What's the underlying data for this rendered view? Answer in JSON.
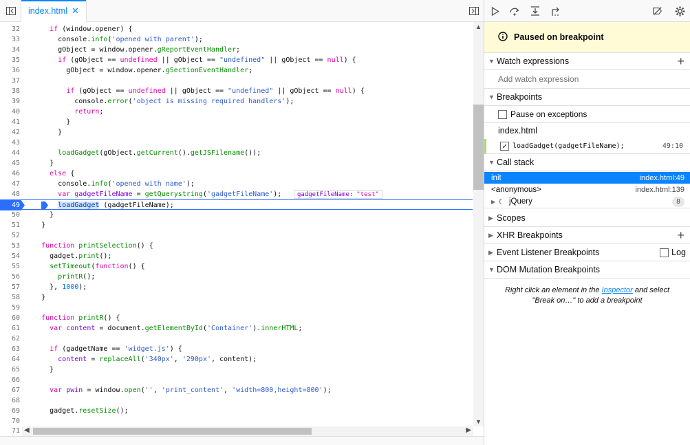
{
  "tab": {
    "filename": "index.html",
    "close": "✕"
  },
  "editor": {
    "lines": [
      {
        "n": "32",
        "html": "      <span class='kw'>if</span> (window.opener) {"
      },
      {
        "n": "33",
        "html": "        console.<span class='prop'>info</span>(<span class='str'>'opened with parent'</span>);"
      },
      {
        "n": "34",
        "html": "        gObject = window.opener.<span class='prop'>gReportEventHandler</span>;"
      },
      {
        "n": "35",
        "html": "        <span class='kw'>if</span> (gObject == <span class='kw'>undefined</span> || gObject == <span class='str'>\"undefined\"</span> || gObject == <span class='kw'>null</span>) {"
      },
      {
        "n": "36",
        "html": "          gObject = window.opener.<span class='prop'>gSectionEventHandler</span>;"
      },
      {
        "n": "37",
        "html": ""
      },
      {
        "n": "38",
        "html": "          <span class='kw'>if</span> (gObject == <span class='kw'>undefined</span> || gObject == <span class='str'>\"undefined\"</span> || gObject == <span class='kw'>null</span>) {"
      },
      {
        "n": "39",
        "html": "            console.<span class='prop'>error</span>(<span class='str'>'object is missing required handlers'</span>);"
      },
      {
        "n": "40",
        "html": "            <span class='kw'>return</span>;"
      },
      {
        "n": "41",
        "html": "          }"
      },
      {
        "n": "42",
        "html": "        }"
      },
      {
        "n": "43",
        "html": ""
      },
      {
        "n": "44",
        "html": "        <span class='prop'>loadGadget</span>(gObject.<span class='prop'>getCurrent</span>().<span class='prop'>getJSFilename</span>());"
      },
      {
        "n": "45",
        "html": "      }"
      },
      {
        "n": "46",
        "html": "      <span class='kw'>else</span> {"
      },
      {
        "n": "47",
        "html": "        console.<span class='prop'>info</span>(<span class='str'>'opened with name'</span>);"
      },
      {
        "n": "48",
        "html": "        <span class='kw'>var</span> <span class='idt'>gadgetFileName</span> = <span class='prop'>getQuerystring</span>(<span class='str'>'gadgetFileName'</span>);"
      },
      {
        "n": "49",
        "html": "        <span style='background:#cfe3ff;color:#003eaa'>loadGadget</span> (gadgetFileName);"
      },
      {
        "n": "50",
        "html": "      }"
      },
      {
        "n": "51",
        "html": "    }"
      },
      {
        "n": "52",
        "html": ""
      },
      {
        "n": "53",
        "html": "    <span class='kw'>function</span> <span class='prop'>printSelection</span>() {"
      },
      {
        "n": "54",
        "html": "      gadget.<span class='prop'>print</span>();"
      },
      {
        "n": "55",
        "html": "      <span class='prop'>setTimeout</span>(<span class='kw'>function</span>() {"
      },
      {
        "n": "56",
        "html": "        <span class='prop'>printR</span>();"
      },
      {
        "n": "57",
        "html": "      }, <span class='num'>1000</span>);"
      },
      {
        "n": "58",
        "html": "    }"
      },
      {
        "n": "59",
        "html": ""
      },
      {
        "n": "60",
        "html": "    <span class='kw'>function</span> <span class='prop'>printR</span>() {"
      },
      {
        "n": "61",
        "html": "      <span class='kw'>var</span> <span class='idt'>content</span> = document.<span class='prop'>getElementById</span>(<span class='str'>'Container'</span>).<span class='prop'>innerHTML</span>;"
      },
      {
        "n": "62",
        "html": ""
      },
      {
        "n": "63",
        "html": "      <span class='kw'>if</span> (gadgetName == <span class='str'>'widget.js'</span>) {"
      },
      {
        "n": "64",
        "html": "        <span class='idt'>content</span> = <span class='prop'>replaceAll</span>(<span class='str'>'340px'</span>, <span class='str'>'290px'</span>, content);"
      },
      {
        "n": "65",
        "html": "      }"
      },
      {
        "n": "66",
        "html": ""
      },
      {
        "n": "67",
        "html": "      <span class='kw'>var</span> <span class='idt'>pwin</span> = window.<span class='prop'>open</span>(<span class='str'>''</span>, <span class='str'>'print_content'</span>, <span class='str'>'width=800,height=800'</span>);"
      },
      {
        "n": "68",
        "html": ""
      },
      {
        "n": "69",
        "html": "      gadget.<span class='prop'>resetSize</span>();"
      },
      {
        "n": "70",
        "html": ""
      },
      {
        "n": "71",
        "html": ""
      }
    ],
    "preview": {
      "name": "gadgetFileName:",
      "value": "\"test\""
    },
    "paused_line": "49"
  },
  "debugger": {
    "paused_text": "Paused on breakpoint",
    "watch": {
      "title": "Watch expressions",
      "placeholder": "Add watch expression"
    },
    "breakpoints": {
      "title": "Breakpoints",
      "pause_on_exceptions": "Pause on exceptions",
      "file": "index.html",
      "item": {
        "code": "loadGadget(gadgetFileName);",
        "location": "49:10"
      }
    },
    "callstack": {
      "title": "Call stack",
      "frames": [
        {
          "name": "init",
          "location": "index.html:49"
        },
        {
          "name": "<anonymous>",
          "location": "index.html:139"
        },
        {
          "name": "jQuery",
          "count": "8"
        }
      ]
    },
    "scopes": "Scopes",
    "xhr": "XHR Breakpoints",
    "event": {
      "title": "Event Listener Breakpoints",
      "log": "Log"
    },
    "dom": {
      "title": "DOM Mutation Breakpoints",
      "hint_before": "Right click an element in the ",
      "hint_link": "Inspector",
      "hint_after": " and select \"Break on…\" to add a breakpoint"
    }
  },
  "colors": {
    "accent": "#0a84ff",
    "paused_bg": "#fffbd6",
    "breakpoint": "#2a6fff"
  }
}
